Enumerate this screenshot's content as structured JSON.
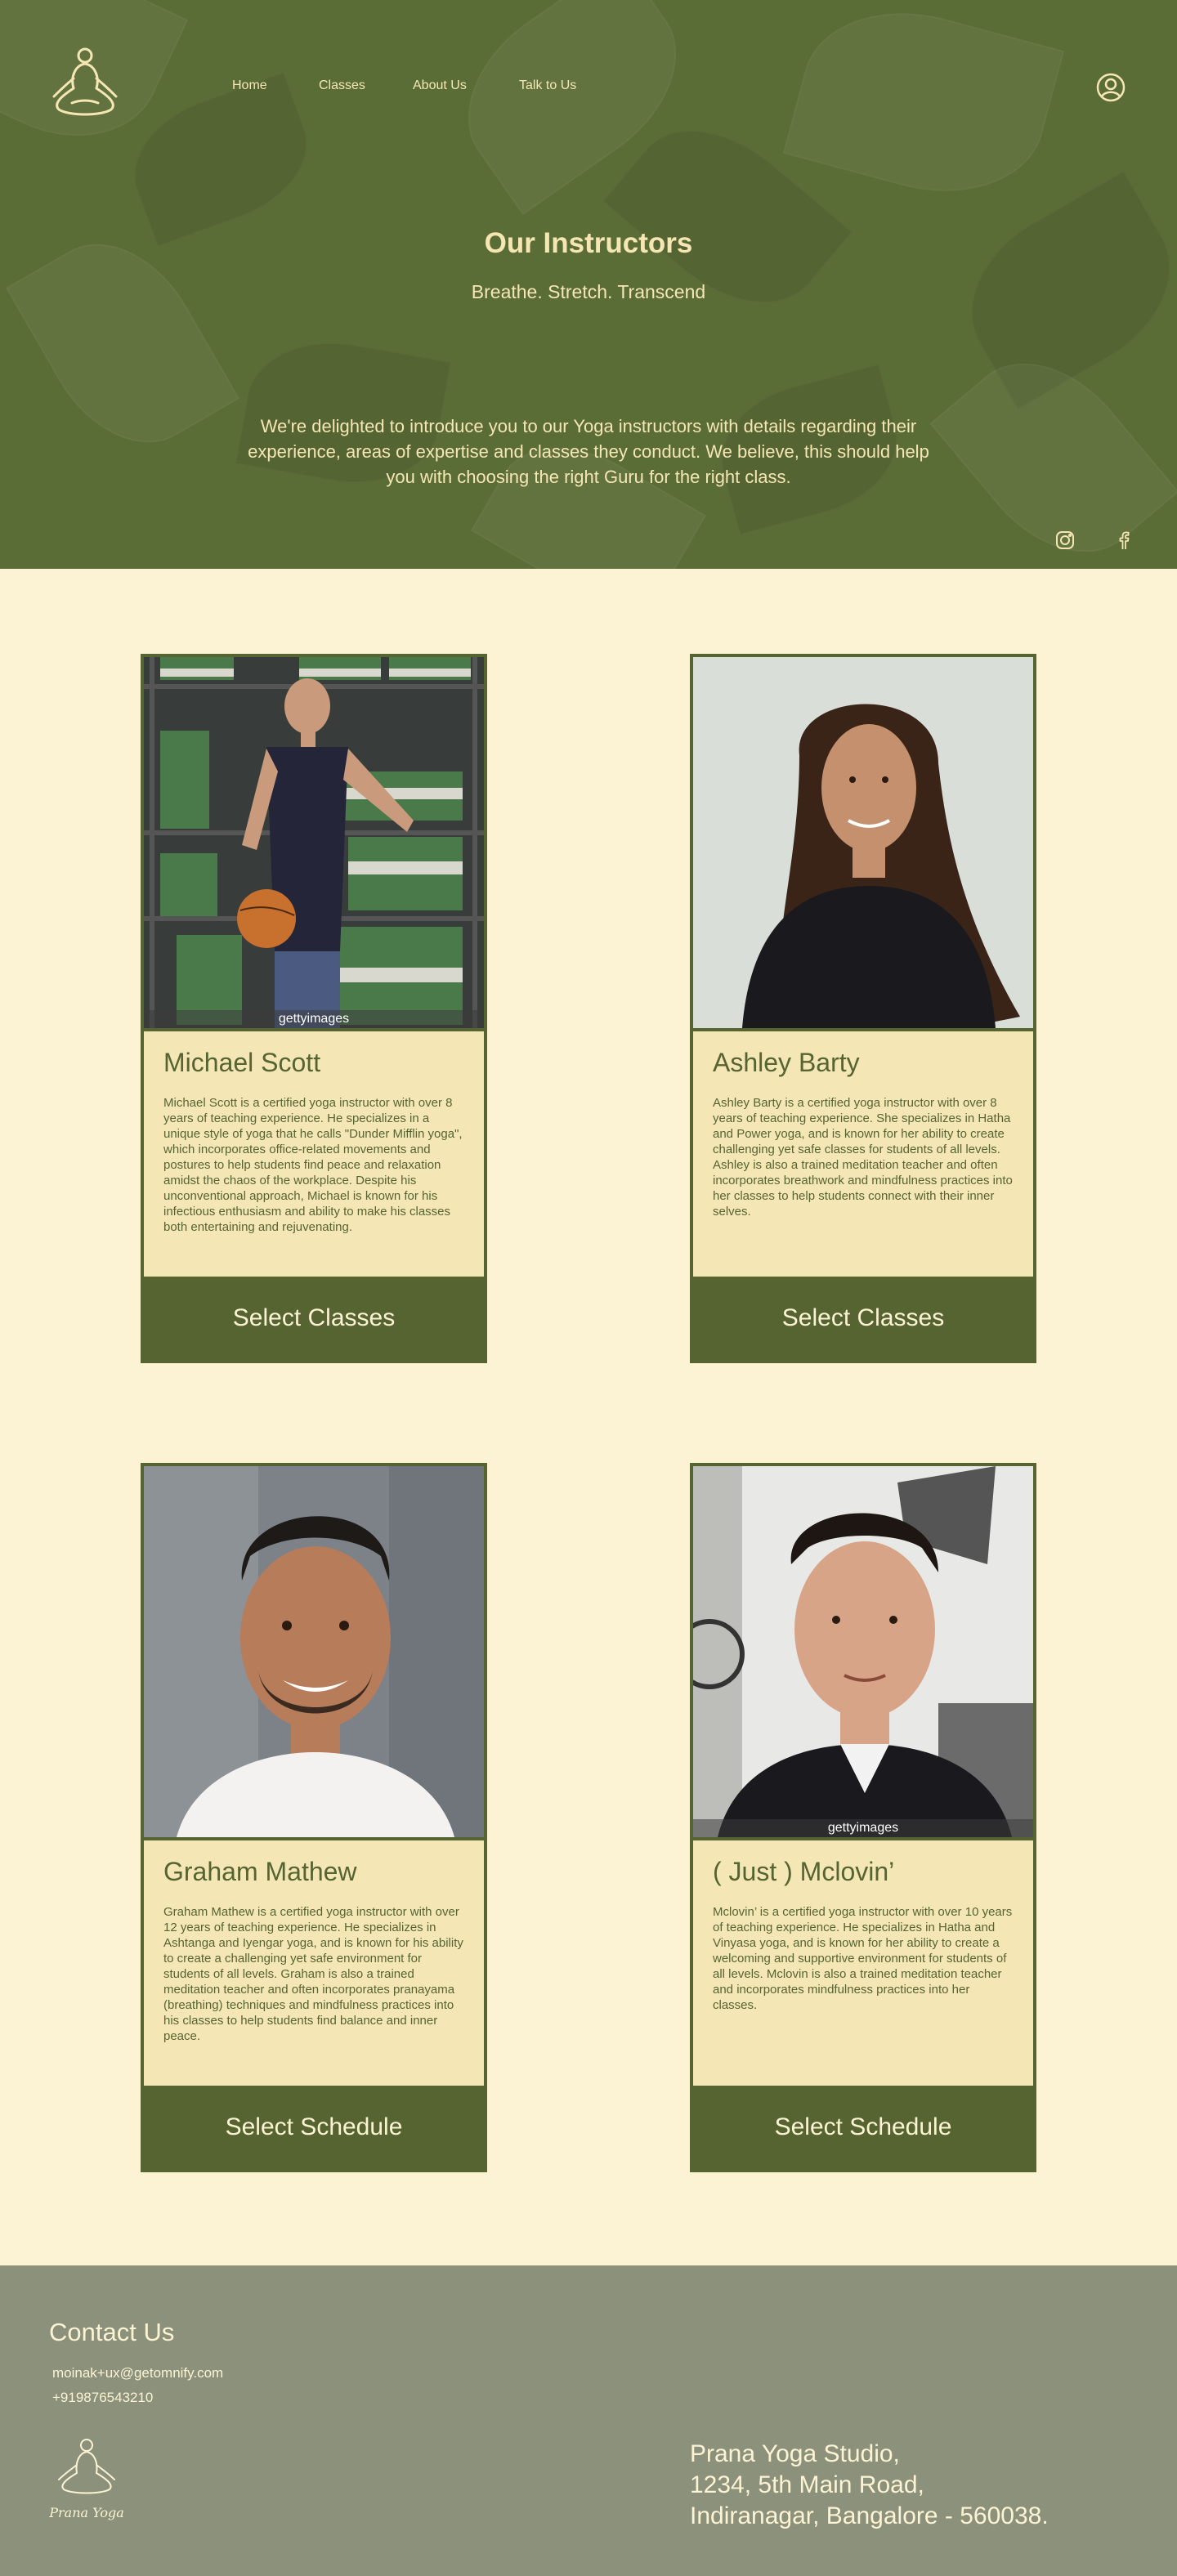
{
  "nav": {
    "items": [
      "Home",
      "Classes",
      "About Us",
      "Talk to Us"
    ]
  },
  "hero": {
    "title": "Our Instructors",
    "subtitle": "Breathe. Stretch. Transcend",
    "intro": "We're delighted to introduce you to our Yoga instructors with details regarding their experience, areas of expertise and classes they conduct. We believe, this should help you with choosing the right Guru for the right class."
  },
  "social": [
    "instagram-icon",
    "facebook-icon"
  ],
  "instructors": [
    {
      "name": "Michael Scott",
      "bio": "Michael Scott is a certified yoga instructor with over 8 years of teaching experience. He specializes in a unique style of yoga that he calls \"Dunder Mifflin yoga\", which incorporates office-related movements and postures to help students find peace and relaxation amidst the chaos of the workplace. Despite his unconventional approach, Michael is known for his infectious enthusiasm and ability to make his classes both entertaining and rejuvenating.",
      "cta": "Select Classes",
      "watermark": "gettyimages"
    },
    {
      "name": "Ashley Barty",
      "bio": "Ashley Barty is a certified yoga instructor with over 8 years of teaching experience. She specializes in Hatha and Power yoga, and is known for her ability to create challenging yet safe classes for students of all levels. Ashley is also a trained meditation teacher and often incorporates breathwork and mindfulness practices into her classes to help students connect with their inner selves.",
      "cta": "Select Classes",
      "watermark": ""
    },
    {
      "name": "Graham Mathew",
      "bio": "Graham Mathew is a certified yoga instructor with over 12 years of teaching experience. He specializes in Ashtanga and Iyengar yoga, and is known for his ability to create a challenging yet safe environment for students of all levels. Graham is also a trained meditation teacher and often incorporates pranayama (breathing) techniques and mindfulness practices into his classes to help students find balance and inner peace.",
      "cta": "Select Schedule",
      "watermark": ""
    },
    {
      "name": "( Just ) Mclovin’",
      "bio": "Mclovin’ is a certified yoga instructor with over 10 years of teaching experience. He specializes in Hatha and Vinyasa yoga, and is known for her ability to create a welcoming and supportive environment for students of all levels. Mclovin is also a trained meditation teacher and incorporates mindfulness practices into her classes.",
      "cta": "Select Schedule",
      "watermark": "gettyimages"
    }
  ],
  "footer": {
    "title": "Contact Us",
    "email": "moinak+ux@getomnify.com",
    "phone": "+919876543210",
    "logo_text": "Prana Yoga",
    "address": [
      "Prana Yoga Studio,",
      "1234, 5th Main Road,",
      "Indiranagar, Bangalore - 560038."
    ]
  },
  "colors": {
    "hero_bg": "#5b6d37",
    "page_bg": "#fbf3d3",
    "card_accent": "#566432",
    "card_body": "#f4e6b5",
    "footer_bg": "#8b917b",
    "cream_text": "#f5e6b3"
  }
}
